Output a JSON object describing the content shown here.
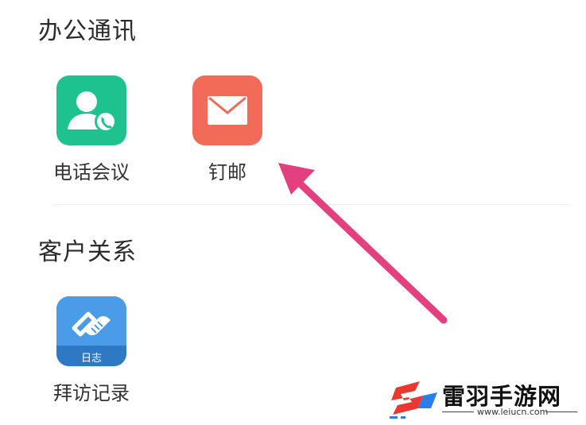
{
  "sections": [
    {
      "title": "办公通讯",
      "apps": [
        {
          "label": "电话会议",
          "icon": "phone-conference-icon",
          "color": "#1ec28f"
        },
        {
          "label": "钉邮",
          "icon": "mail-envelope-icon",
          "color": "#f26b59"
        }
      ]
    },
    {
      "title": "客户关系",
      "apps": [
        {
          "label": "拜访记录",
          "icon": "handshake-icon",
          "color": "#3b8fe0",
          "badge": "日志"
        }
      ]
    }
  ],
  "annotation": {
    "arrow_color": "#e2407f"
  },
  "watermark": {
    "title": "雷羽手游网",
    "url": "www.leiucn.com",
    "logo_colors": [
      "#e8382f",
      "#2b7de9"
    ]
  }
}
